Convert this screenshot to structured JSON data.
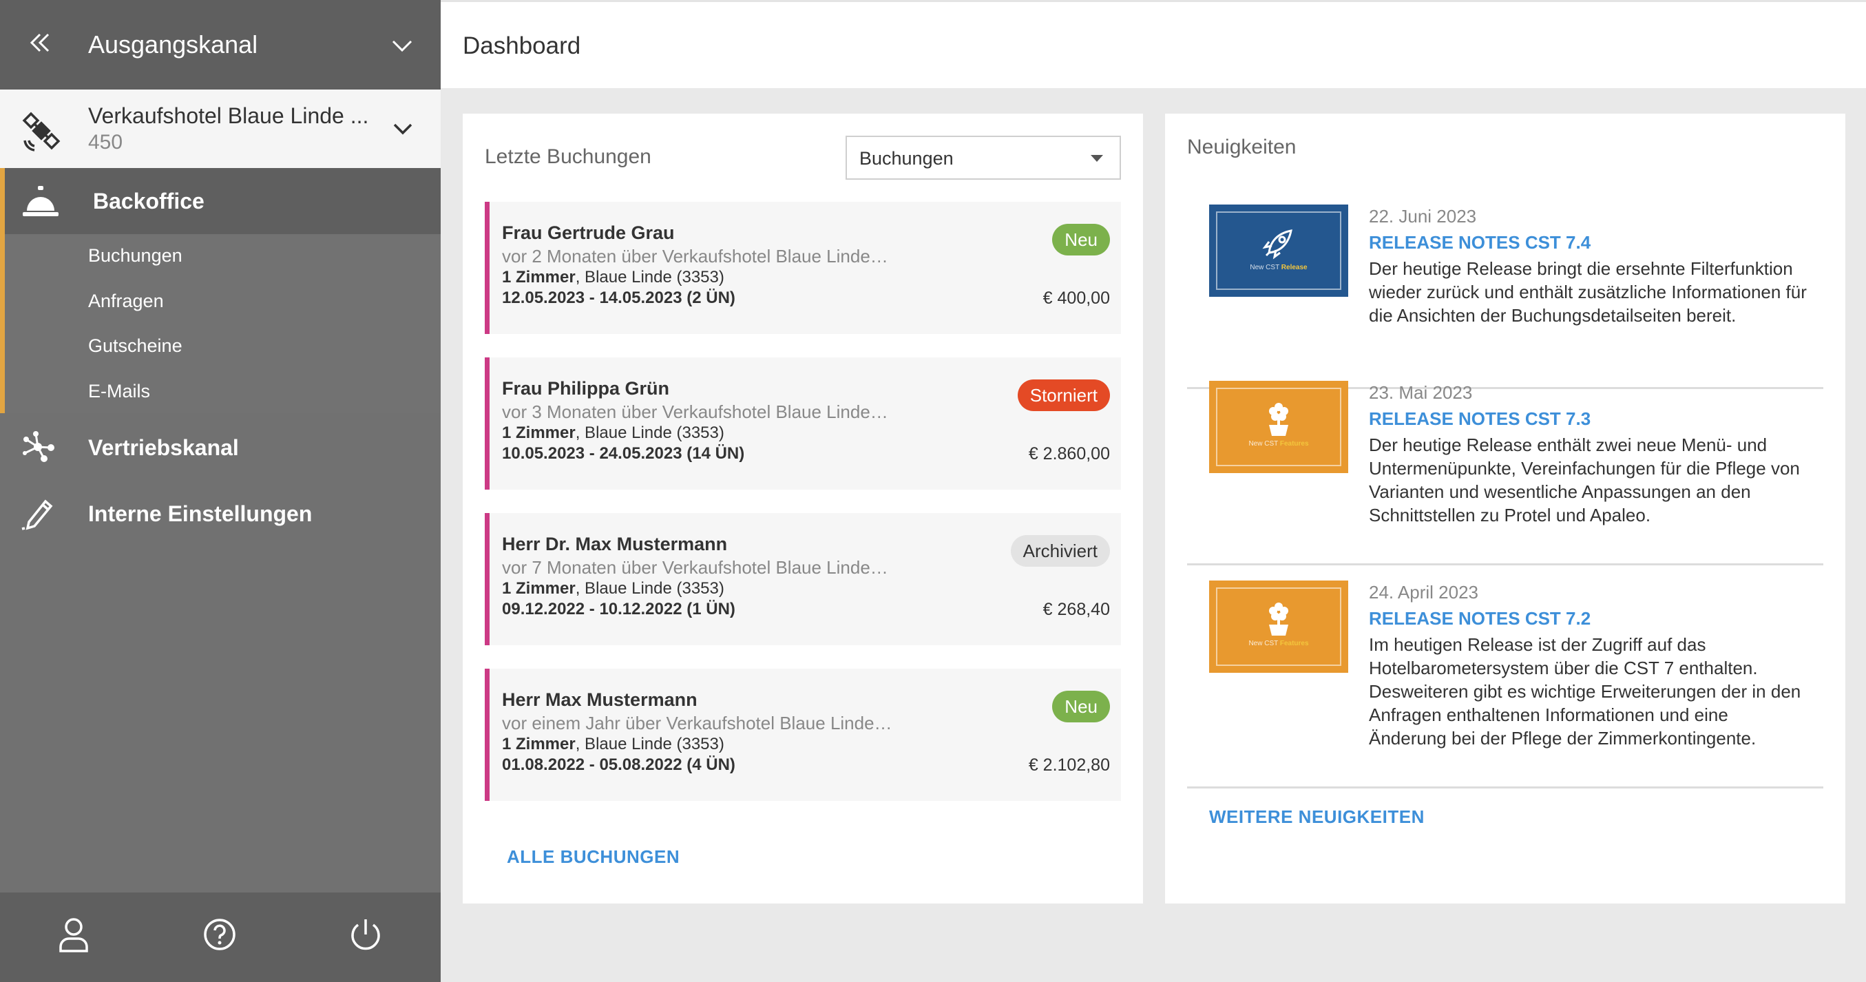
{
  "sidebar": {
    "channel_title": "Ausgangskanal",
    "hotel_name": "Verkaufshotel Blaue Linde ...",
    "hotel_number": "450",
    "backoffice_label": "Backoffice",
    "backoffice_items": [
      {
        "label": "Buchungen"
      },
      {
        "label": "Anfragen"
      },
      {
        "label": "Gutscheine"
      },
      {
        "label": "E-Mails"
      }
    ],
    "vertriebskanal_label": "Vertriebskanal",
    "interne_label": "Interne Einstellungen",
    "accent_color": "#e2a542"
  },
  "header": {
    "title": "Dashboard"
  },
  "bookings": {
    "title": "Letzte Buchungen",
    "filter_value": "Buchungen",
    "all_link": "ALLE BUCHUNGEN",
    "items": [
      {
        "name": "Frau Gertrude Grau",
        "subtitle": "vor 2 Monaten über Verkaufshotel Blaue Linde…",
        "rooms": "1 Zimmer",
        "room_detail": ", Blaue Linde (3353)",
        "dates": "12.05.2023 - 14.05.2023 (2 ÜN)",
        "price": "€ 400,00",
        "status": "Neu"
      },
      {
        "name": "Frau Philippa Grün",
        "subtitle": "vor 3 Monaten über Verkaufshotel Blaue Linde…",
        "rooms": "1 Zimmer",
        "room_detail": ", Blaue Linde (3353)",
        "dates": "10.05.2023 - 24.05.2023 (14 ÜN)",
        "price": "€ 2.860,00",
        "status": "Storniert"
      },
      {
        "name": "Herr Dr. Max Mustermann",
        "subtitle": "vor 7 Monaten über Verkaufshotel Blaue Linde…",
        "rooms": "1 Zimmer",
        "room_detail": ", Blaue Linde (3353)",
        "dates": "09.12.2022 - 10.12.2022 (1 ÜN)",
        "price": "€ 268,40",
        "status": "Archiviert"
      },
      {
        "name": "Herr Max Mustermann",
        "subtitle": "vor einem Jahr über Verkaufshotel Blaue Linde…",
        "rooms": "1 Zimmer",
        "room_detail": ", Blaue Linde (3353)",
        "dates": "01.08.2022 - 05.08.2022 (4 ÜN)",
        "price": "€ 2.102,80",
        "status": "Neu"
      }
    ],
    "status_colors": {
      "Neu": "#7cb14c",
      "Storniert": "#e44a25",
      "Archiviert": "#e3e3e3"
    }
  },
  "news": {
    "title": "Neuigkeiten",
    "more_link": "WEITERE NEUIGKEITEN",
    "items": [
      {
        "date": "22. Juni 2023",
        "title": "RELEASE NOTES CST 7.4",
        "text": "Der heutige Release bringt die ersehnte Filterfunktion wieder zurück und enthält zusätzliche Informationen für die Ansichten der Buchungsdetailseiten bereit.",
        "thumb_color": "#24578f",
        "thumb_icon": "rocket-icon",
        "thumb_caption_prefix": "New CST",
        "thumb_caption_word": "Release"
      },
      {
        "date": "23. Mai 2023",
        "title": "RELEASE NOTES CST 7.3",
        "text": "Der heutige Release enthält zwei neue Menü- und Untermenüpunkte, Vereinfachungen für die Pflege von Varianten und wesentliche Anpassungen an den Schnittstellen zu Protel und Apaleo.",
        "thumb_color": "#e8992f",
        "thumb_icon": "flower-icon",
        "thumb_caption_prefix": "New CST",
        "thumb_caption_word": "Features"
      },
      {
        "date": "24. April 2023",
        "title": "RELEASE NOTES CST 7.2",
        "text": "Im heutigen Release ist der Zugriff auf das Hotelbarometersystem über die CST 7 enthalten. Desweiteren gibt es wichtige Erweiterungen der in den Anfragen enthaltenen Informationen und eine Änderung bei der Pflege der Zimmerkontingente.",
        "thumb_color": "#e8992f",
        "thumb_icon": "flower-icon",
        "thumb_caption_prefix": "New CST",
        "thumb_caption_word": "Features"
      }
    ]
  }
}
